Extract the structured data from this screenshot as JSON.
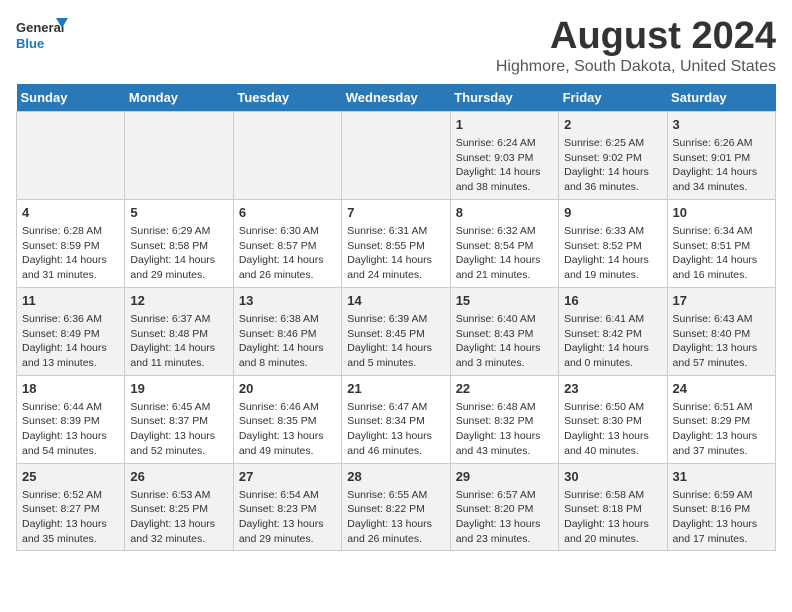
{
  "logo": {
    "line1": "General",
    "line2": "Blue"
  },
  "title": "August 2024",
  "subtitle": "Highmore, South Dakota, United States",
  "days_of_week": [
    "Sunday",
    "Monday",
    "Tuesday",
    "Wednesday",
    "Thursday",
    "Friday",
    "Saturday"
  ],
  "weeks": [
    [
      {
        "num": "",
        "info": ""
      },
      {
        "num": "",
        "info": ""
      },
      {
        "num": "",
        "info": ""
      },
      {
        "num": "",
        "info": ""
      },
      {
        "num": "1",
        "info": "Sunrise: 6:24 AM\nSunset: 9:03 PM\nDaylight: 14 hours and 38 minutes."
      },
      {
        "num": "2",
        "info": "Sunrise: 6:25 AM\nSunset: 9:02 PM\nDaylight: 14 hours and 36 minutes."
      },
      {
        "num": "3",
        "info": "Sunrise: 6:26 AM\nSunset: 9:01 PM\nDaylight: 14 hours and 34 minutes."
      }
    ],
    [
      {
        "num": "4",
        "info": "Sunrise: 6:28 AM\nSunset: 8:59 PM\nDaylight: 14 hours and 31 minutes."
      },
      {
        "num": "5",
        "info": "Sunrise: 6:29 AM\nSunset: 8:58 PM\nDaylight: 14 hours and 29 minutes."
      },
      {
        "num": "6",
        "info": "Sunrise: 6:30 AM\nSunset: 8:57 PM\nDaylight: 14 hours and 26 minutes."
      },
      {
        "num": "7",
        "info": "Sunrise: 6:31 AM\nSunset: 8:55 PM\nDaylight: 14 hours and 24 minutes."
      },
      {
        "num": "8",
        "info": "Sunrise: 6:32 AM\nSunset: 8:54 PM\nDaylight: 14 hours and 21 minutes."
      },
      {
        "num": "9",
        "info": "Sunrise: 6:33 AM\nSunset: 8:52 PM\nDaylight: 14 hours and 19 minutes."
      },
      {
        "num": "10",
        "info": "Sunrise: 6:34 AM\nSunset: 8:51 PM\nDaylight: 14 hours and 16 minutes."
      }
    ],
    [
      {
        "num": "11",
        "info": "Sunrise: 6:36 AM\nSunset: 8:49 PM\nDaylight: 14 hours and 13 minutes."
      },
      {
        "num": "12",
        "info": "Sunrise: 6:37 AM\nSunset: 8:48 PM\nDaylight: 14 hours and 11 minutes."
      },
      {
        "num": "13",
        "info": "Sunrise: 6:38 AM\nSunset: 8:46 PM\nDaylight: 14 hours and 8 minutes."
      },
      {
        "num": "14",
        "info": "Sunrise: 6:39 AM\nSunset: 8:45 PM\nDaylight: 14 hours and 5 minutes."
      },
      {
        "num": "15",
        "info": "Sunrise: 6:40 AM\nSunset: 8:43 PM\nDaylight: 14 hours and 3 minutes."
      },
      {
        "num": "16",
        "info": "Sunrise: 6:41 AM\nSunset: 8:42 PM\nDaylight: 14 hours and 0 minutes."
      },
      {
        "num": "17",
        "info": "Sunrise: 6:43 AM\nSunset: 8:40 PM\nDaylight: 13 hours and 57 minutes."
      }
    ],
    [
      {
        "num": "18",
        "info": "Sunrise: 6:44 AM\nSunset: 8:39 PM\nDaylight: 13 hours and 54 minutes."
      },
      {
        "num": "19",
        "info": "Sunrise: 6:45 AM\nSunset: 8:37 PM\nDaylight: 13 hours and 52 minutes."
      },
      {
        "num": "20",
        "info": "Sunrise: 6:46 AM\nSunset: 8:35 PM\nDaylight: 13 hours and 49 minutes."
      },
      {
        "num": "21",
        "info": "Sunrise: 6:47 AM\nSunset: 8:34 PM\nDaylight: 13 hours and 46 minutes."
      },
      {
        "num": "22",
        "info": "Sunrise: 6:48 AM\nSunset: 8:32 PM\nDaylight: 13 hours and 43 minutes."
      },
      {
        "num": "23",
        "info": "Sunrise: 6:50 AM\nSunset: 8:30 PM\nDaylight: 13 hours and 40 minutes."
      },
      {
        "num": "24",
        "info": "Sunrise: 6:51 AM\nSunset: 8:29 PM\nDaylight: 13 hours and 37 minutes."
      }
    ],
    [
      {
        "num": "25",
        "info": "Sunrise: 6:52 AM\nSunset: 8:27 PM\nDaylight: 13 hours and 35 minutes."
      },
      {
        "num": "26",
        "info": "Sunrise: 6:53 AM\nSunset: 8:25 PM\nDaylight: 13 hours and 32 minutes."
      },
      {
        "num": "27",
        "info": "Sunrise: 6:54 AM\nSunset: 8:23 PM\nDaylight: 13 hours and 29 minutes."
      },
      {
        "num": "28",
        "info": "Sunrise: 6:55 AM\nSunset: 8:22 PM\nDaylight: 13 hours and 26 minutes."
      },
      {
        "num": "29",
        "info": "Sunrise: 6:57 AM\nSunset: 8:20 PM\nDaylight: 13 hours and 23 minutes."
      },
      {
        "num": "30",
        "info": "Sunrise: 6:58 AM\nSunset: 8:18 PM\nDaylight: 13 hours and 20 minutes."
      },
      {
        "num": "31",
        "info": "Sunrise: 6:59 AM\nSunset: 8:16 PM\nDaylight: 13 hours and 17 minutes."
      }
    ]
  ]
}
